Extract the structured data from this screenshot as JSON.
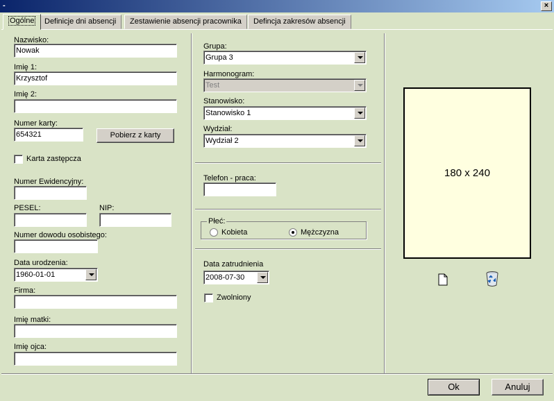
{
  "window": {
    "title": "-",
    "close_label": "×"
  },
  "tabs": [
    {
      "label": "Ogólne"
    },
    {
      "label": "Definicje dni absencji"
    },
    {
      "label": "Zestawienie absencji pracownika"
    },
    {
      "label": "Defincja zakresów absencji"
    }
  ],
  "left": {
    "nazwisko_label": "Nazwisko:",
    "nazwisko_value": "Nowak",
    "imie1_label": "Imię 1:",
    "imie1_value": "Krzysztof",
    "imie2_label": "Imię 2:",
    "imie2_value": "",
    "numer_karty_label": "Numer karty:",
    "numer_karty_value": "654321",
    "pobierz_button": "Pobierz z karty",
    "karta_zastepcza_label": "Karta zastępcza",
    "numer_ewid_label": "Numer Ewidencyjny:",
    "numer_ewid_value": "",
    "pesel_label": "PESEL:",
    "pesel_value": "",
    "nip_label": "NIP:",
    "nip_value": "",
    "dowod_label": "Numer dowodu osobistego:",
    "dowod_value": "",
    "data_ur_label": "Data urodzenia:",
    "data_ur_value": "1960-01-01",
    "firma_label": "Firma:",
    "firma_value": "",
    "imie_matki_label": "Imię matki:",
    "imie_matki_value": "",
    "imie_ojca_label": "Imię ojca:",
    "imie_ojca_value": ""
  },
  "middle": {
    "grupa_label": "Grupa:",
    "grupa_value": "Grupa 3",
    "harmonogram_label": "Harmonogram:",
    "harmonogram_value": "Test",
    "stanowisko_label": "Stanowisko:",
    "stanowisko_value": "Stanowisko 1",
    "wydzial_label": "Wydział:",
    "wydzial_value": "Wydział 2",
    "telefon_label": "Telefon - praca:",
    "telefon_value": "",
    "plec_label": "Płeć:",
    "kobieta_label": "Kobieta",
    "mezczyzna_label": "Mężczyzna",
    "data_zatr_label": "Data zatrudnienia",
    "data_zatr_value": "2008-07-30",
    "zwolniony_label": "Zwolniony"
  },
  "photo": {
    "size_text": "180 x 240"
  },
  "footer": {
    "ok_label": "Ok",
    "cancel_label": "Anuluj"
  },
  "colors": {
    "background": "#d9e3c6",
    "photo_background": "#ffffe0",
    "titlebar": "#0a246a"
  }
}
